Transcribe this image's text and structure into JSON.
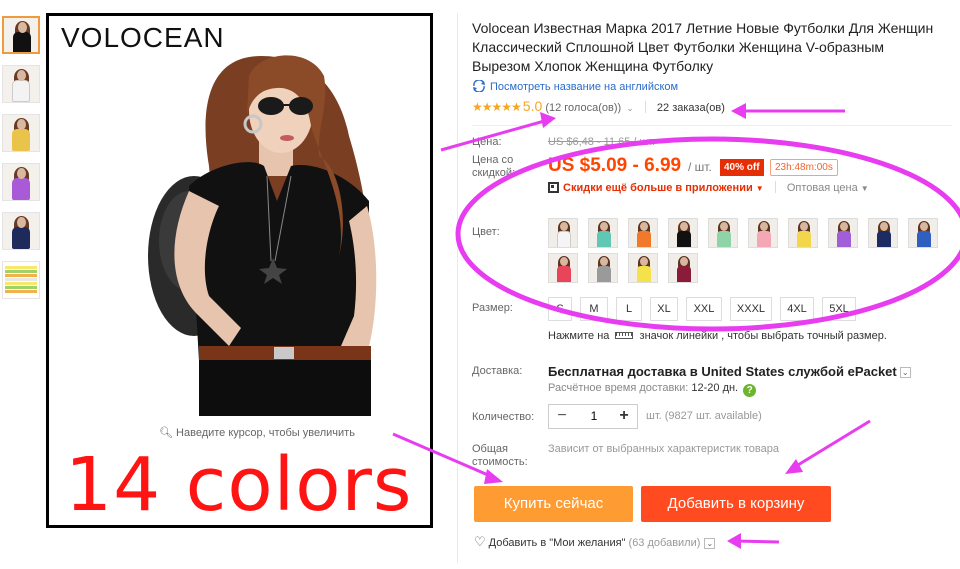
{
  "thumbnails": [
    {
      "name": "black",
      "color": "#111111",
      "active": true
    },
    {
      "name": "white",
      "color": "#f3f3f3",
      "active": false
    },
    {
      "name": "yellow",
      "color": "#e9c34a",
      "active": false
    },
    {
      "name": "purple",
      "color": "#a95ad6",
      "active": false
    },
    {
      "name": "navy",
      "color": "#1f2a5c",
      "active": false
    },
    {
      "name": "size-chart",
      "color": "#ffffff",
      "active": false
    }
  ],
  "main_image": {
    "brand": "VOLOCEAN",
    "zoom_hint": "Наведите курсор, чтобы увеличить",
    "caption": "14 colors"
  },
  "product": {
    "title": "Volocean Известная Марка 2017 Летние Новые Футболки Для Женщин Классический Сплошной Цвет Футболки Женщина V-образным Вырезом Хлопок Женщина Футболку",
    "translate_link": "Посмотреть название на английском",
    "stars": "★★★★★",
    "rating": "5.0",
    "votes": "(12 голоса(ов))",
    "orders": "22 заказа(ов)"
  },
  "pricing": {
    "price_label": "Цена:",
    "old_price": "US $6,48 - 11,65 / шт.",
    "discount_label_1": "Цена со",
    "discount_label_2": "скидкой:",
    "price": "US $5.09 - 6.99",
    "unit": "/ шт.",
    "off": "40% off",
    "timer": "23h:48m:00s",
    "app_discount": "Скидки ещё больше в приложении",
    "wholesale": "Оптовая цена"
  },
  "color": {
    "label": "Цвет:",
    "swatches": [
      {
        "name": "white",
        "color": "#f5f5f5"
      },
      {
        "name": "mint",
        "color": "#5fc7b4"
      },
      {
        "name": "orange",
        "color": "#f07a2a"
      },
      {
        "name": "black",
        "color": "#111111"
      },
      {
        "name": "light-green",
        "color": "#8fd3a8"
      },
      {
        "name": "pink",
        "color": "#f4a7b4"
      },
      {
        "name": "yellow",
        "color": "#f2d64b"
      },
      {
        "name": "purple",
        "color": "#a05fd8"
      },
      {
        "name": "navy",
        "color": "#1d2b63"
      },
      {
        "name": "blue",
        "color": "#2f5fbf"
      },
      {
        "name": "red",
        "color": "#e8455a"
      },
      {
        "name": "gray",
        "color": "#9a9a9a"
      },
      {
        "name": "lemon",
        "color": "#f5e24a"
      },
      {
        "name": "wine",
        "color": "#8a1c3a"
      }
    ]
  },
  "size": {
    "label": "Размер:",
    "options": [
      "S",
      "M",
      "L",
      "XL",
      "XXL",
      "XXXL",
      "4XL",
      "5XL"
    ],
    "hint_before": "Нажмите на",
    "hint_after": "значок линейки , чтобы выбрать точный размер."
  },
  "shipping": {
    "label": "Доставка:",
    "main": "Бесплатная доставка в United States службой ePacket",
    "time_label": "Расчётное время доставки:",
    "time_value": "12-20 дн."
  },
  "quantity": {
    "label": "Количество:",
    "value": "1",
    "available": "шт. (9827 шт. available)"
  },
  "total": {
    "label_1": "Общая",
    "label_2": "стоимость:",
    "note": "Зависит от выбранных характеристик товара"
  },
  "actions": {
    "buy_now": "Купить сейчас",
    "add_to_cart": "Добавить в корзину",
    "wishlist": "Добавить в \"Мои желания\"",
    "wishlist_count": "(63 добавили)"
  },
  "colors": {
    "accent_orange": "#ff9b33",
    "cart_red": "#ff4b1f",
    "price_red": "#ff4500",
    "annotation_magenta": "#e83cf0",
    "caption_red": "#ff1414"
  }
}
